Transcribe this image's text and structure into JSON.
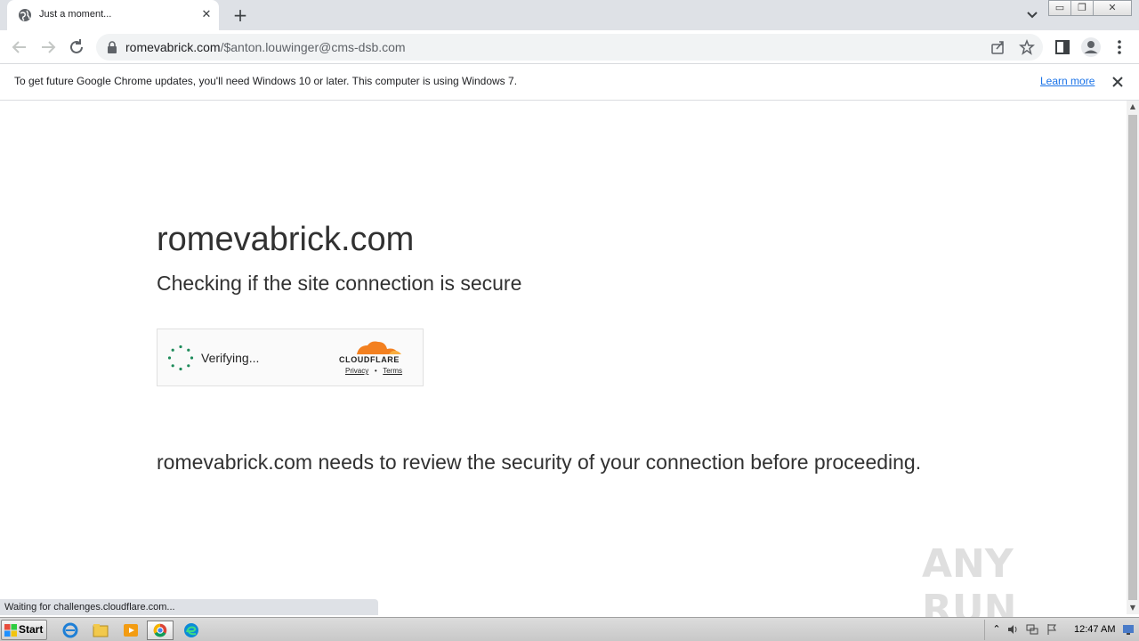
{
  "browser": {
    "tab": {
      "title": "Just a moment...",
      "close_glyph": "✕",
      "favicon": "globe-icon"
    },
    "new_tab_glyph": "+",
    "window_buttons": {
      "minimize": "▭",
      "restore": "❐",
      "close": "✕"
    },
    "url": {
      "host": "romevabrick.com",
      "path": "/$anton.louwinger@cms-dsb.com"
    },
    "infobar": {
      "message": "To get future Google Chrome updates, you'll need Windows 10 or later. This computer is using Windows 7.",
      "link": "Learn more"
    },
    "status": "Waiting for challenges.cloudflare.com..."
  },
  "page": {
    "title": "romevabrick.com",
    "subtitle": "Checking if the site connection is secure",
    "widget": {
      "status": "Verifying...",
      "brand": "CLOUDFLARE",
      "privacy": "Privacy",
      "separator": "•",
      "terms": "Terms"
    },
    "review": "romevabrick.com needs to review the security of your connection before proceeding."
  },
  "watermark": "ANY RUN",
  "taskbar": {
    "start": "Start",
    "apps": [
      "internet-explorer-icon",
      "file-explorer-icon",
      "media-player-icon",
      "chrome-icon",
      "edge-icon"
    ],
    "clock": "12:47 AM"
  },
  "colors": {
    "tabstrip": "#dee1e6",
    "link": "#1a73e8",
    "cloudflare_orange": "#f38020",
    "spinner": "#1e8b5a",
    "text": "#313131"
  }
}
